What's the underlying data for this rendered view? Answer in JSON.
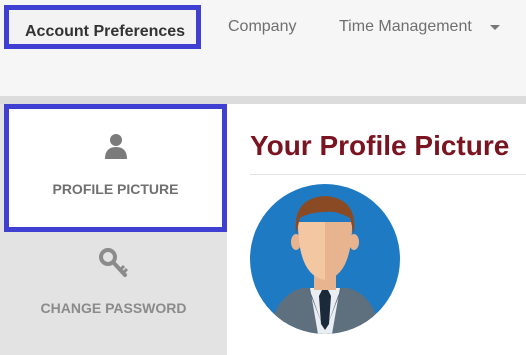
{
  "topnav": {
    "tabs": [
      {
        "label": "Account Preferences",
        "active": true
      },
      {
        "label": "Company"
      },
      {
        "label": "Time Management",
        "has_dropdown": true
      }
    ]
  },
  "sidebar": {
    "items": [
      {
        "label": "PROFILE PICTURE",
        "icon": "user-icon",
        "active": true
      },
      {
        "label": "CHANGE PASSWORD",
        "icon": "key-icon"
      }
    ]
  },
  "main": {
    "title": "Your Profile Picture",
    "avatar_icon": "avatar"
  },
  "colors": {
    "title": "#7a1420",
    "highlight": "#3f3fd1",
    "avatar_bg": "#1f7ac4"
  }
}
